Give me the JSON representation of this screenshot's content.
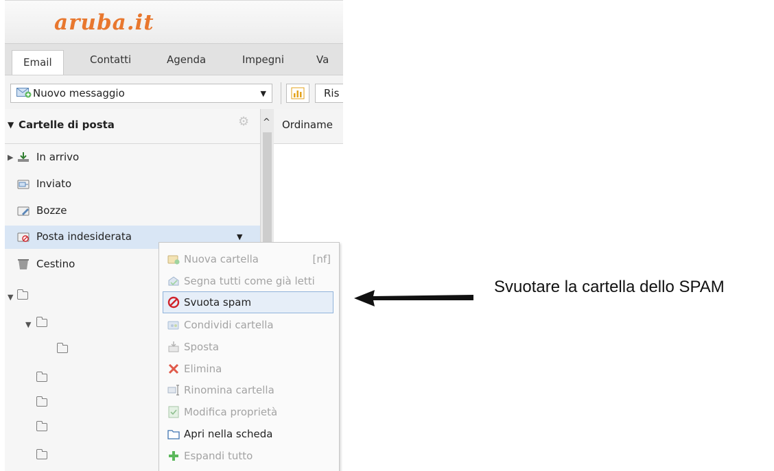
{
  "logo_text": "aruba.it",
  "tabs": [
    {
      "label": "Email",
      "active": true
    },
    {
      "label": "Contatti",
      "active": false
    },
    {
      "label": "Agenda",
      "active": false
    },
    {
      "label": "Impegni",
      "active": false
    },
    {
      "label": "Va",
      "active": false
    }
  ],
  "toolbar": {
    "new_message_label": "Nuovo messaggio",
    "new_message_icon": "envelope-plus-icon",
    "stats_icon": "bar-chart-icon",
    "partial_button_label": "Ris"
  },
  "sidebar": {
    "header": "Cartelle di posta",
    "folders": [
      {
        "label": "In arrivo",
        "icon": "inbox-download-icon"
      },
      {
        "label": "Inviato",
        "icon": "sent-folder-icon"
      },
      {
        "label": "Bozze",
        "icon": "drafts-folder-icon"
      },
      {
        "label": "Posta indesiderata",
        "icon": "spam-folder-icon",
        "selected": true
      },
      {
        "label": "Cestino",
        "icon": "trash-icon"
      }
    ]
  },
  "main": {
    "sort_header": "Ordiname"
  },
  "context_menu": {
    "items": [
      {
        "label": "Nuova cartella",
        "shortcut": "[nf]",
        "icon": "new-folder-icon",
        "enabled": false
      },
      {
        "label": "Segna tutti come già letti",
        "icon": "mark-read-icon",
        "enabled": false
      },
      {
        "label": "Svuota spam",
        "icon": "prohibited-icon",
        "enabled": true,
        "highlighted": true
      },
      {
        "label": "Condividi cartella",
        "icon": "share-folder-icon",
        "enabled": false
      },
      {
        "label": "Sposta",
        "icon": "move-icon",
        "enabled": false
      },
      {
        "label": "Elimina",
        "icon": "delete-x-icon",
        "enabled": false
      },
      {
        "label": "Rinomina cartella",
        "icon": "rename-icon",
        "enabled": false
      },
      {
        "label": "Modifica proprietà",
        "icon": "edit-properties-icon",
        "enabled": false
      },
      {
        "label": "Apri nella scheda",
        "icon": "open-in-tab-icon",
        "enabled": true
      },
      {
        "label": "Espandi tutto",
        "icon": "expand-plus-icon",
        "enabled": false
      }
    ]
  },
  "annotation": {
    "text": "Svuotare la cartella dello SPAM"
  },
  "colors": {
    "logo": "#e8772e",
    "selected_folder_bg": "#d9e6f5",
    "menu_highlight_bg": "#e6eef8",
    "menu_highlight_border": "#8fb2da",
    "prohibited_red": "#d0222a",
    "delete_red": "#e05a4a",
    "expand_green": "#5cb85c"
  }
}
